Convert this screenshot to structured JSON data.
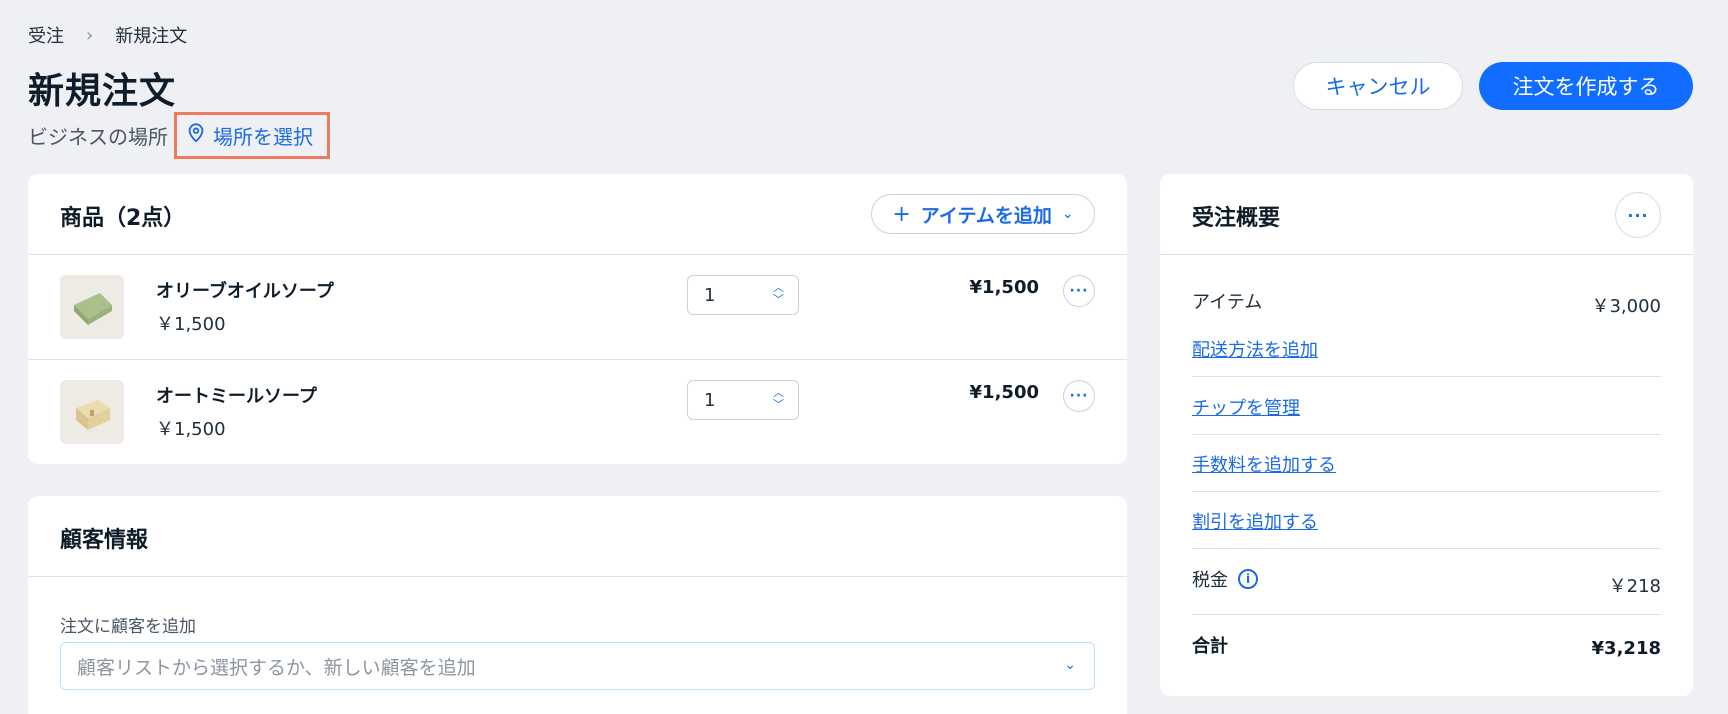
{
  "breadcrumb": {
    "parent": "受注",
    "separator": "›",
    "current": "新規注文"
  },
  "header": {
    "title": "新規注文",
    "location_label": "ビジネスの場所",
    "location_select": "場所を選択",
    "cancel_label": "キャンセル",
    "create_label": "注文を作成する"
  },
  "products": {
    "title": "商品（2点）",
    "add_item_label": "アイテムを追加",
    "items": [
      {
        "name": "オリーブオイルソープ",
        "price": "￥1,500",
        "quantity": "1",
        "total": "¥1,500"
      },
      {
        "name": "オートミールソープ",
        "price": "￥1,500",
        "quantity": "1",
        "total": "¥1,500"
      }
    ]
  },
  "customer": {
    "title": "顧客情報",
    "field_label": "注文に顧客を追加",
    "placeholder": "顧客リストから選択するか、新しい顧客を追加"
  },
  "summary": {
    "title": "受注概要",
    "items_label": "アイテム",
    "items_value": "￥3,000",
    "shipping_link": "配送方法を追加",
    "tip_link": "チップを管理",
    "fee_link": "手数料を追加する",
    "discount_link": "割引を追加する",
    "tax_label": "税金",
    "tax_value": "￥218",
    "total_label": "合計",
    "total_value": "¥3,218"
  },
  "colors": {
    "accent": "#116dff",
    "link": "#1a6be5",
    "highlight_border": "#ee7b5d",
    "background": "#eef0f4"
  },
  "icons": [
    "chevron-right-icon",
    "location-pin-icon",
    "plus-icon",
    "chevron-down-icon",
    "more-icon",
    "stepper-arrows-icon",
    "info-icon"
  ]
}
